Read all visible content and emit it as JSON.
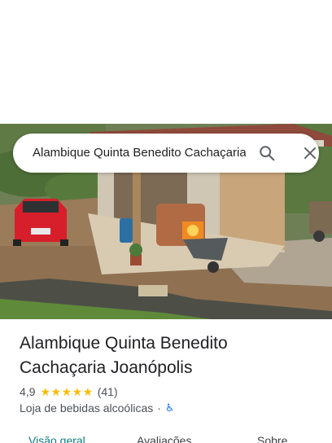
{
  "search": {
    "query": "Alambique Quinta Benedito Cachaçaria Joanópolis"
  },
  "icons": {
    "search": "search-icon",
    "close": "close-icon",
    "accessibility": "wheelchair-icon"
  },
  "place": {
    "name_line1": "Alambique Quinta Benedito",
    "name_line2": "Cachaçaria Joanópolis",
    "rating": "4,9",
    "stars": 5,
    "stars_text": "★★★★★",
    "review_count": "(41)",
    "category": "Loja de bebidas alcoólicas",
    "separator": "·",
    "wheelchair_glyph": "♿"
  },
  "tabs": [
    {
      "label": "Visão geral",
      "active": true
    },
    {
      "label": "Avaliações",
      "active": false
    },
    {
      "label": "Sobre",
      "active": false
    }
  ],
  "colors": {
    "accent_tab": "#0b7c82",
    "star": "#fbbc04",
    "accessibility": "#1a73e8"
  }
}
